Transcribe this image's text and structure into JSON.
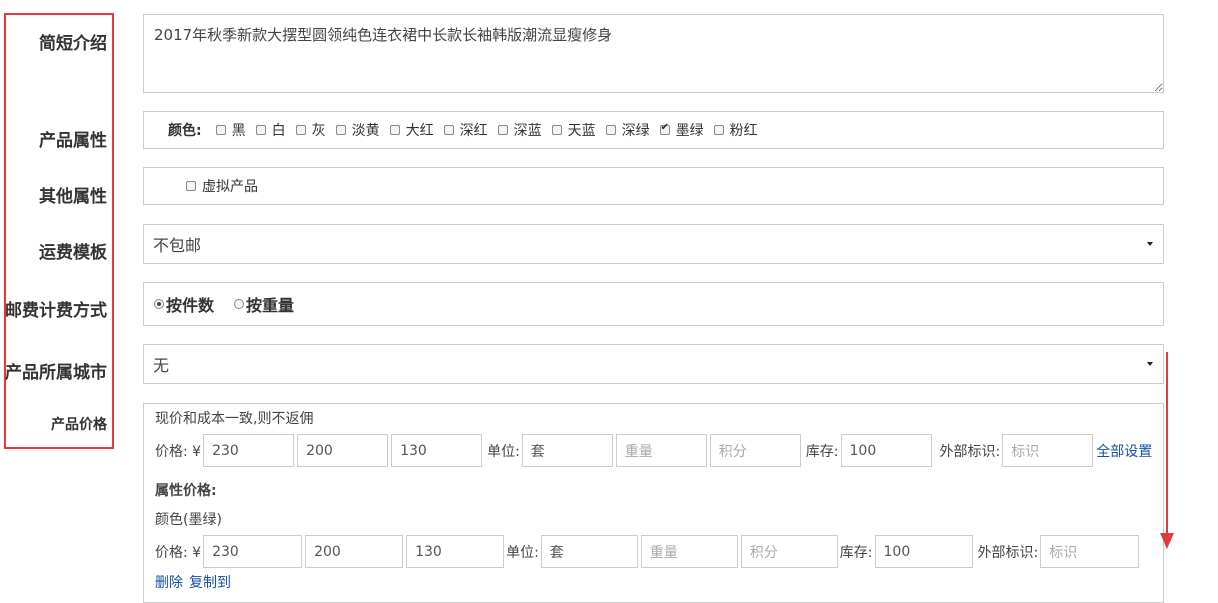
{
  "labels": {
    "intro": "简短介绍",
    "attributes": "产品属性",
    "other": "其他属性",
    "shipping_template": "运费模板",
    "postage_method": "邮费计费方式",
    "city": "产品所属城市",
    "price": "产品价格"
  },
  "intro": {
    "value": "2017年秋季新款大摆型圆领纯色连衣裙中长款长袖韩版潮流显瘦修身"
  },
  "attributes": {
    "color_label": "颜色:",
    "colors": [
      {
        "label": "黑",
        "checked": false
      },
      {
        "label": "白",
        "checked": false
      },
      {
        "label": "灰",
        "checked": false
      },
      {
        "label": "淡黄",
        "checked": false
      },
      {
        "label": "大红",
        "checked": false
      },
      {
        "label": "深红",
        "checked": false
      },
      {
        "label": "深蓝",
        "checked": false
      },
      {
        "label": "天蓝",
        "checked": false
      },
      {
        "label": "深绿",
        "checked": false
      },
      {
        "label": "墨绿",
        "checked": true
      },
      {
        "label": "粉红",
        "checked": false
      }
    ]
  },
  "other": {
    "virtual_label": "虚拟产品",
    "virtual_checked": false
  },
  "shipping_template": {
    "selected": "不包邮"
  },
  "postage_method": {
    "options": [
      "按件数",
      "按重量"
    ],
    "selected": "按件数"
  },
  "city": {
    "selected": "无"
  },
  "price": {
    "note": "现价和成本一致,则不返佣",
    "main": {
      "price_label": "价格: ¥",
      "values": [
        "230",
        "200",
        "130"
      ],
      "unit_label": "单位:",
      "unit": "套",
      "weight_ph": "重量",
      "points_ph": "积分",
      "stock_label": "库存:",
      "stock": "100",
      "ext_label": "外部标识:",
      "ext_ph": "标识",
      "set_all": "全部设置"
    },
    "attr_heading": "属性价格:",
    "attr_name": "颜色(墨绿)",
    "attr": {
      "price_label": "价格: ¥",
      "values": [
        "230",
        "200",
        "130"
      ],
      "unit_label": "单位:",
      "unit": "套",
      "weight_ph": "重量",
      "points_ph": "积分",
      "stock_label": "库存:",
      "stock": "100",
      "ext_label": "外部标识:",
      "ext_ph": "标识"
    },
    "delete": "删除",
    "copy_to": "复制到"
  },
  "colors": {
    "highlight": "#e0393e",
    "link": "#1a4fa3"
  }
}
